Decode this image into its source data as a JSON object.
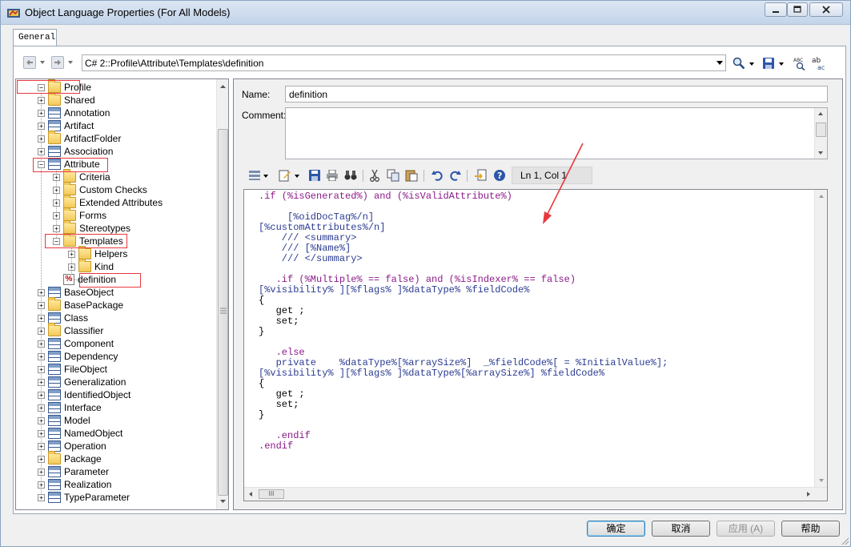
{
  "window": {
    "title": "Object Language Properties (For All Models)",
    "minimize_label": "minimize",
    "maximize_label": "maximize",
    "close_label": "close"
  },
  "tabs": [
    {
      "label": "General",
      "selected": true
    }
  ],
  "navigation": {
    "path": "C# 2::Profile\\Attribute\\Templates\\definition"
  },
  "tree": {
    "items": [
      {
        "label": "Profile",
        "icon": "folder-open-icon",
        "expanded": true,
        "highlighted": true
      },
      {
        "label": "Shared",
        "icon": "folder-icon"
      },
      {
        "label": "Annotation",
        "icon": "class-icon"
      },
      {
        "label": "Artifact",
        "icon": "artifact-icon"
      },
      {
        "label": "ArtifactFolder",
        "icon": "folder-icon"
      },
      {
        "label": "Association",
        "icon": "association-icon"
      },
      {
        "label": "Attribute",
        "icon": "class-icon",
        "expanded": true,
        "highlighted": true
      },
      {
        "label": "Criteria",
        "icon": "folder-icon"
      },
      {
        "label": "Custom Checks",
        "icon": "folder-icon"
      },
      {
        "label": "Extended Attributes",
        "icon": "folder-icon"
      },
      {
        "label": "Forms",
        "icon": "folder-icon"
      },
      {
        "label": "Stereotypes",
        "icon": "folder-icon"
      },
      {
        "label": "Templates",
        "icon": "folder-open-icon",
        "expanded": true,
        "highlighted": true
      },
      {
        "label": "Helpers",
        "icon": "folder-icon"
      },
      {
        "label": "Kind",
        "icon": "folder-icon"
      },
      {
        "label": "definition",
        "icon": "template-icon",
        "selected": true,
        "highlighted": true
      },
      {
        "label": "BaseObject",
        "icon": "class-icon"
      },
      {
        "label": "BasePackage",
        "icon": "folder-icon"
      },
      {
        "label": "Class",
        "icon": "class-icon"
      },
      {
        "label": "Classifier",
        "icon": "folder-icon"
      },
      {
        "label": "Component",
        "icon": "component-icon"
      },
      {
        "label": "Dependency",
        "icon": "dependency-icon"
      },
      {
        "label": "FileObject",
        "icon": "artifact-icon"
      },
      {
        "label": "Generalization",
        "icon": "generalization-icon"
      },
      {
        "label": "IdentifiedObject",
        "icon": "class-icon"
      },
      {
        "label": "Interface",
        "icon": "class-icon"
      },
      {
        "label": "Model",
        "icon": "model-icon"
      },
      {
        "label": "NamedObject",
        "icon": "class-icon"
      },
      {
        "label": "Operation",
        "icon": "class-icon"
      },
      {
        "label": "Package",
        "icon": "folder-icon"
      },
      {
        "label": "Parameter",
        "icon": "class-icon"
      },
      {
        "label": "Realization",
        "icon": "dependency-icon"
      },
      {
        "label": "TypeParameter",
        "icon": "class-icon"
      }
    ]
  },
  "form": {
    "name_label": "Name:",
    "name_value": "definition",
    "comment_label": "Comment:",
    "comment_value": ""
  },
  "editor": {
    "position": "Ln 1, Col 1",
    "code_lines": [
      ".if (%isGenerated%) and (%isValidAttribute%)",
      "",
      "     [%oidDocTag%/n]",
      "[%customAttributes%/n]",
      "    /// <summary>",
      "    /// [%Name%]",
      "    /// </summary>",
      "",
      "   .if (%Multiple% == false) and (%isIndexer% == false)",
      "[%visibility% ][%flags% ]%dataType% %fieldCode%",
      "{",
      "   get ;",
      "   set;",
      "}",
      "",
      "   .else",
      "   private    %dataType%[%arraySize%]  _%fieldCode%[ = %InitialValue%];",
      "[%visibility% ][%flags% ]%dataType%[%arraySize%] %fieldCode%",
      "{",
      "   get ;",
      "   set;",
      "}",
      "",
      "   .endif",
      ".endif"
    ]
  },
  "buttons": {
    "ok": "确定",
    "cancel": "取消",
    "apply": "应用 (A)",
    "help": "帮助"
  },
  "colors": {
    "annotation_red": "#e8383d",
    "keyword_purple": "#8b1a89",
    "var_blue": "#2b3b91"
  }
}
